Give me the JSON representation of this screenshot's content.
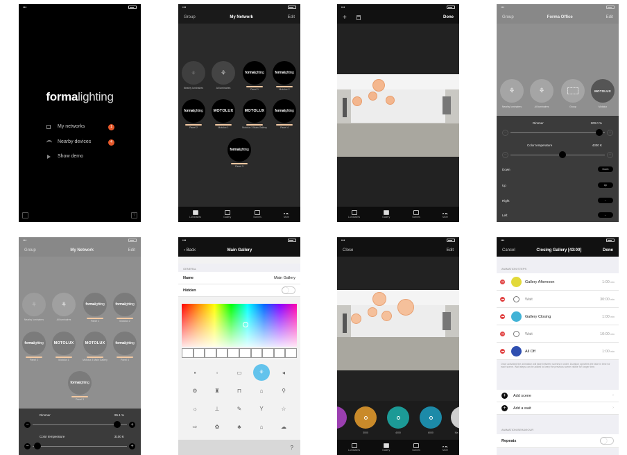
{
  "screen1": {
    "logo_bold": "forma",
    "logo_light": "lighting",
    "menu": [
      {
        "label": "My networks",
        "badge": "1"
      },
      {
        "label": "Nearby devices",
        "badge": "4"
      },
      {
        "label": "Show demo",
        "badge": ""
      }
    ]
  },
  "network_screen": {
    "nav_left": "Group",
    "title": "My Network",
    "nav_right": "Edit",
    "labels": {
      "nearby": "Nearby luminaires",
      "all": "All luminaires",
      "panel1": "Panel 1",
      "motolux2": "Motolux 2",
      "panel2": "Panel 2",
      "motolux1": "Motolux 1",
      "motolux3": "Motolux 3 Main Gallery",
      "panel4": "Panel 4",
      "panel3": "Panel 3"
    },
    "brand_bold": "forma",
    "brand_light": "lighting",
    "motolux": "MOTOLUX"
  },
  "tabs": [
    "Luminaires",
    "Gallery",
    "Scenes",
    "More"
  ],
  "scene_edit": {
    "nav_right": "Done"
  },
  "office_screen": {
    "nav_left": "Group",
    "title": "Forma Office",
    "nav_right": "Edit",
    "icon_labels": [
      "Nearby luminaires",
      "All luminaires",
      "Group",
      "Motolux"
    ],
    "dimmer_label": "Dimmer",
    "dimmer_value": "100.0 %",
    "dimmer_level": 0.94,
    "ct_label": "Color temperature",
    "ct_value": "4300 K",
    "ct_level": 0.55,
    "rows": [
      {
        "label": "Down",
        "button": "Down"
      },
      {
        "label": "Up",
        "button": "Up"
      },
      {
        "label": "Right",
        "button": "→"
      },
      {
        "label": "Left",
        "button": "←"
      }
    ]
  },
  "network_dim": {
    "dimmer_label": "Dimmer",
    "dimmer_value": "95.1 %",
    "dimmer_level": 0.9,
    "ct_label": "Color temperature",
    "ct_value": "3100 K",
    "ct_level": 0.05
  },
  "main_gallery": {
    "back": "Back",
    "title": "Main Gallery",
    "section": "GENERAL",
    "name_label": "Name",
    "name_value": "Main Gallery",
    "hidden_label": "Hidden",
    "help": "?"
  },
  "gallery_close": {
    "nav_left": "Close",
    "nav_right": "Edit",
    "scenes": [
      {
        "color": "#9b3fb0",
        "label": ""
      },
      {
        "color": "#c98a2a",
        "label": "3000"
      },
      {
        "color": "#1c9a96",
        "label": "4000"
      },
      {
        "color": "#1c8aa8",
        "label": "6000"
      },
      {
        "color": "#cfcfcf",
        "label": "Ma"
      }
    ]
  },
  "closing": {
    "cancel": "Cancel",
    "title": "Closing Gallery [43:00]",
    "done": "Done",
    "section1": "ANIMATION STEPS",
    "steps": [
      {
        "name": "Gallery Afternoon",
        "dur": "1:00",
        "unit": "min",
        "color": "#e2d93a"
      },
      {
        "name": "Wait",
        "dur": "30:00",
        "unit": "min",
        "color": ""
      },
      {
        "name": "Gallery Closing",
        "dur": "1:00",
        "unit": "min",
        "color": "#42b3d6"
      },
      {
        "name": "Wait",
        "dur": "10:00",
        "unit": "min",
        "color": ""
      },
      {
        "name": "All Off",
        "dur": "1:00",
        "unit": "min",
        "color": "#2f4fb0"
      }
    ],
    "info": "Once activated the animation will fade between scenes in order. Duration specifies the fade in time for each scene. Wait steps can be added to keep the previous scene visible for longer time.",
    "add_scene": "Add scene",
    "add_wait": "Add a wait",
    "section2": "ANIMATION BEHAVIOUR",
    "repeats": "Repeats"
  }
}
